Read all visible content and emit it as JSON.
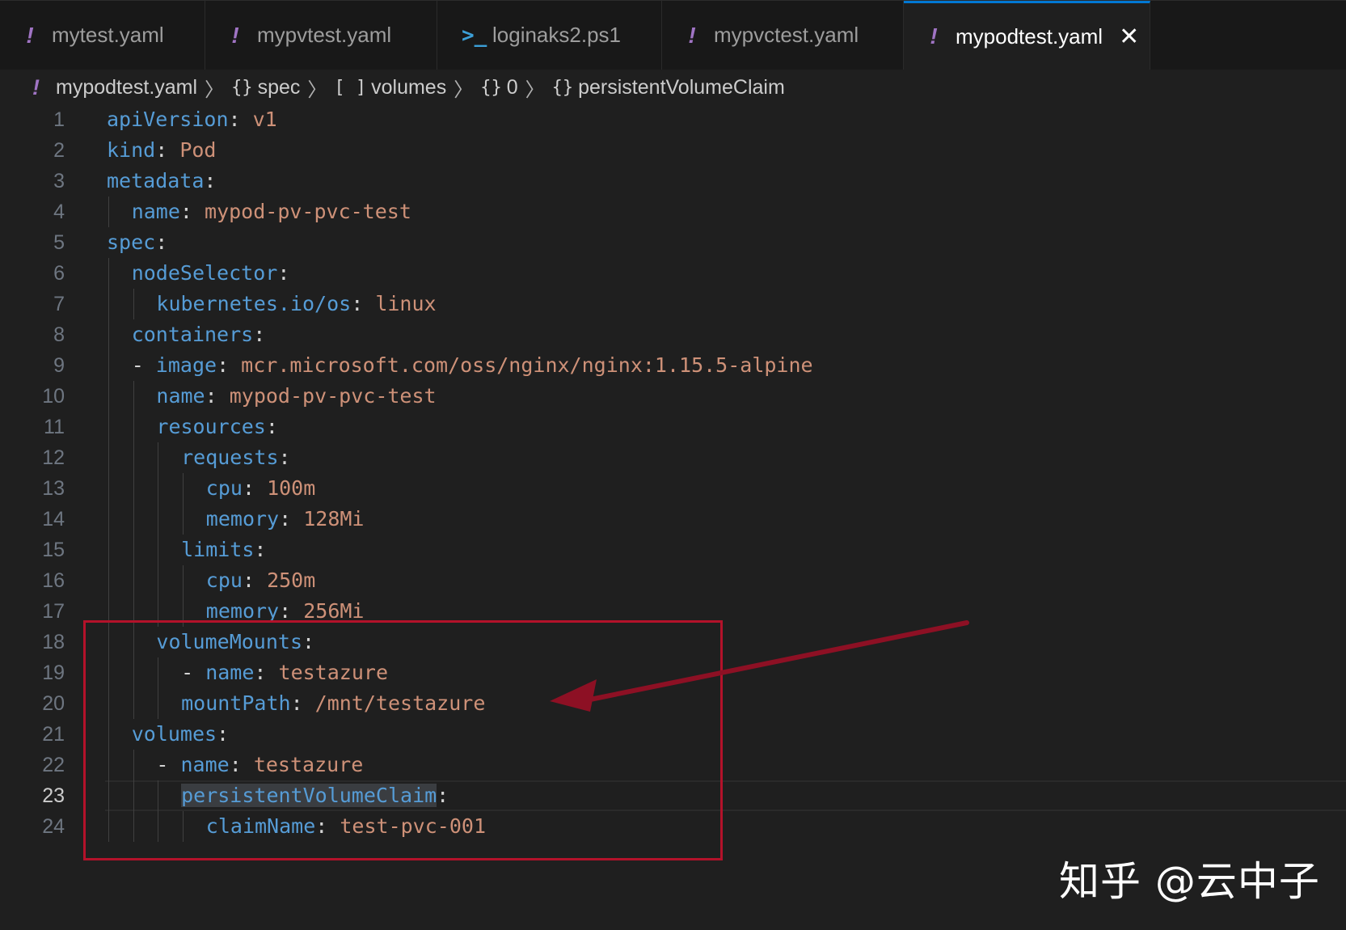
{
  "tabs": [
    {
      "icon": "!",
      "label": "mytest.yaml",
      "active": false
    },
    {
      "icon": "!",
      "label": "mypvtest.yaml",
      "active": false
    },
    {
      "icon": ">_",
      "label": "loginaks2.ps1",
      "active": false
    },
    {
      "icon": "!",
      "label": "mypvctest.yaml",
      "active": false
    },
    {
      "icon": "!",
      "label": "mypodtest.yaml",
      "active": true,
      "close": "✕"
    }
  ],
  "breadcrumb": {
    "file": "mypodtest.yaml",
    "items": [
      {
        "sym": "{}",
        "label": "spec"
      },
      {
        "sym": "[ ]",
        "label": "volumes"
      },
      {
        "sym": "{}",
        "label": "0"
      },
      {
        "sym": "{}",
        "label": "persistentVolumeClaim"
      }
    ]
  },
  "lines": [
    {
      "n": "1",
      "dash": "",
      "key": "apiVersion",
      "val": "v1"
    },
    {
      "n": "2",
      "dash": "",
      "key": "kind",
      "val": "Pod"
    },
    {
      "n": "3",
      "dash": "",
      "key": "metadata",
      "val": ""
    },
    {
      "n": "4",
      "dash": "",
      "key": "name",
      "val": "mypod-pv-pvc-test"
    },
    {
      "n": "5",
      "dash": "",
      "key": "spec",
      "val": ""
    },
    {
      "n": "6",
      "dash": "",
      "key": "nodeSelector",
      "val": ""
    },
    {
      "n": "7",
      "dash": "",
      "key": "kubernetes.io/os",
      "val": "linux"
    },
    {
      "n": "8",
      "dash": "",
      "key": "containers",
      "val": ""
    },
    {
      "n": "9",
      "dash": "- ",
      "key": "image",
      "val": "mcr.microsoft.com/oss/nginx/nginx:1.15.5-alpine"
    },
    {
      "n": "10",
      "dash": "",
      "key": "name",
      "val": "mypod-pv-pvc-test"
    },
    {
      "n": "11",
      "dash": "",
      "key": "resources",
      "val": ""
    },
    {
      "n": "12",
      "dash": "",
      "key": "requests",
      "val": ""
    },
    {
      "n": "13",
      "dash": "",
      "key": "cpu",
      "val": "100m"
    },
    {
      "n": "14",
      "dash": "",
      "key": "memory",
      "val": "128Mi"
    },
    {
      "n": "15",
      "dash": "",
      "key": "limits",
      "val": ""
    },
    {
      "n": "16",
      "dash": "",
      "key": "cpu",
      "val": "250m"
    },
    {
      "n": "17",
      "dash": "",
      "key": "memory",
      "val": "256Mi"
    },
    {
      "n": "18",
      "dash": "",
      "key": "volumeMounts",
      "val": ""
    },
    {
      "n": "19",
      "dash": "- ",
      "key": "name",
      "val": "testazure"
    },
    {
      "n": "20",
      "dash": "",
      "key": "mountPath",
      "val": "/mnt/testazure"
    },
    {
      "n": "21",
      "dash": "",
      "key": "volumes",
      "val": ""
    },
    {
      "n": "22",
      "dash": "- ",
      "key": "name",
      "val": "testazure"
    },
    {
      "n": "23",
      "dash": "",
      "key": "persistentVolumeClaim",
      "val": ""
    },
    {
      "n": "24",
      "dash": "",
      "key": "claimName",
      "val": "test-pvc-001"
    }
  ],
  "current_line": "23",
  "watermark": "知乎 @云中子",
  "colors": {
    "key": "#569cd6",
    "value": "#ce9178",
    "annotation": "#b3122a"
  }
}
